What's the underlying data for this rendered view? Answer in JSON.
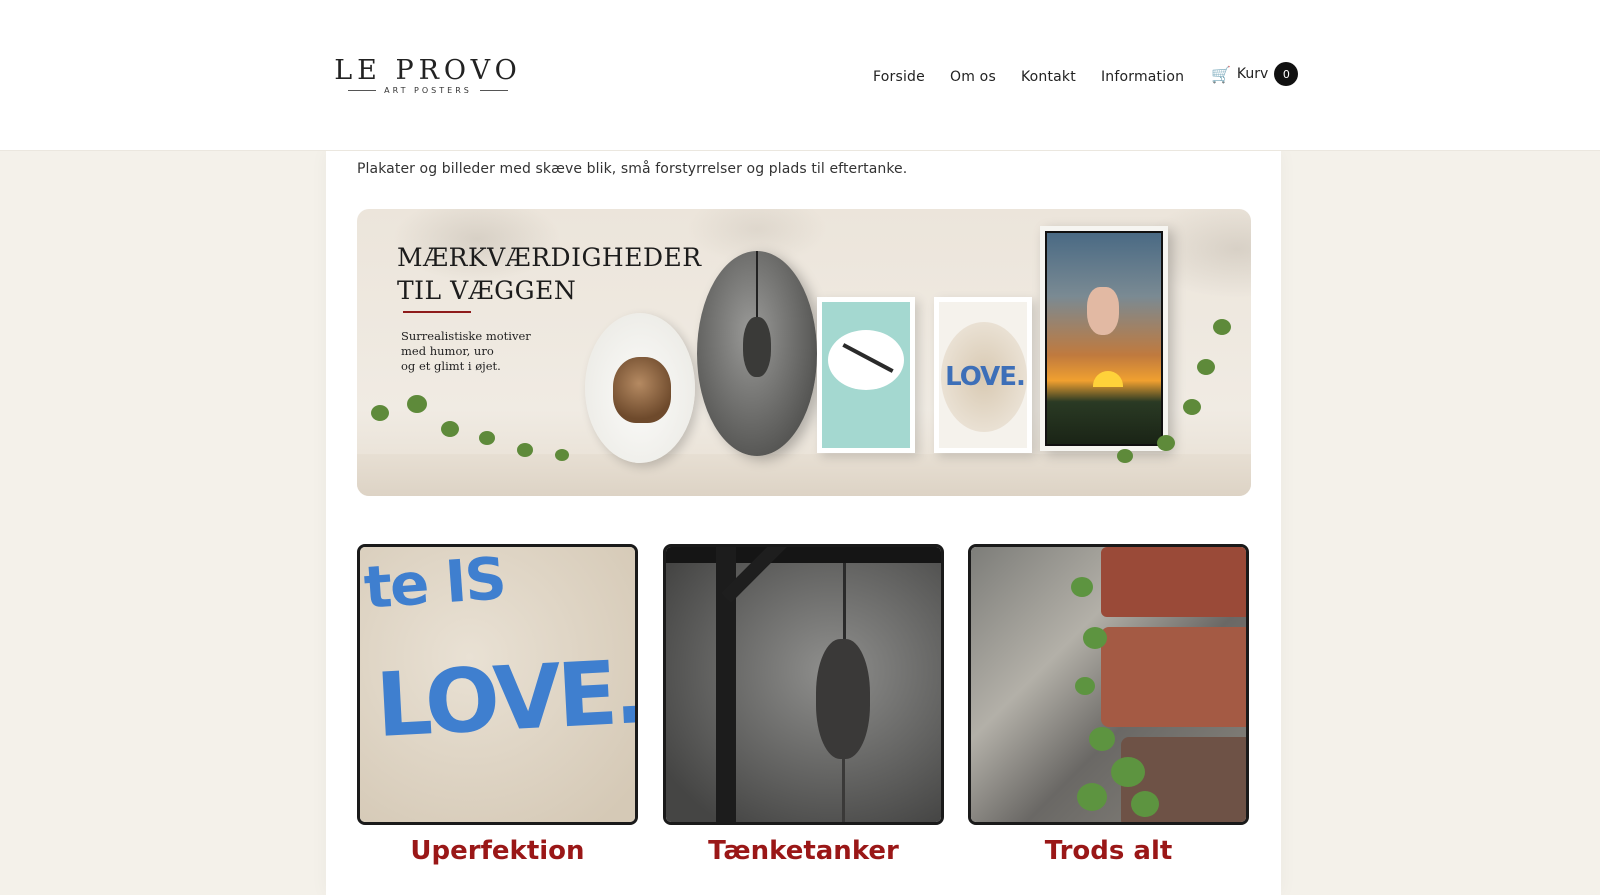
{
  "header": {
    "logo_main": "LE PROVO",
    "logo_sub": "ART POSTERS",
    "nav": [
      "Forside",
      "Om os",
      "Kontakt",
      "Information"
    ],
    "cart_label": "Kurv",
    "cart_count": "0",
    "cart_icon": "cart-icon"
  },
  "main": {
    "tagline": "Plakater og billeder med skæve blik, små forstyrrelser og plads til eftertanke.",
    "hero": {
      "title_line1": "MÆRKVÆRDIGHEDER",
      "title_line2": "TIL VÆGGEN",
      "sub_lines": [
        "Surrealistiske motiver",
        "med humor, uro",
        "og et glimt i øjet."
      ],
      "love_text": "LOVE."
    },
    "categories": [
      {
        "title": "Uperfektion",
        "img_text_1": "te IS",
        "img_text_2": "LOVE."
      },
      {
        "title": "Tænketanker"
      },
      {
        "title": "Trods alt"
      }
    ]
  },
  "colors": {
    "accent": "#9a1717",
    "background": "#f4f1ea",
    "badge": "#111111"
  }
}
